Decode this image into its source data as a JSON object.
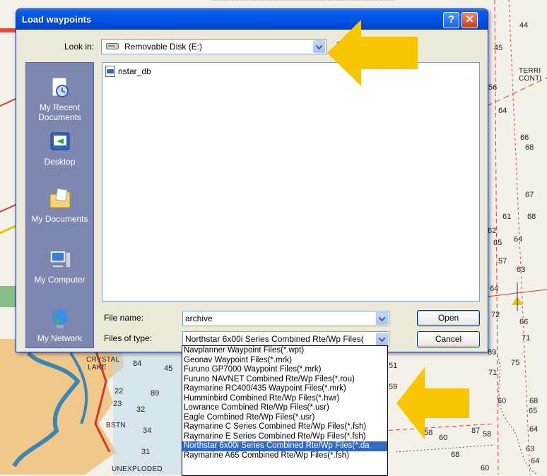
{
  "dialog": {
    "title": "Load waypoints",
    "help_glyph": "?",
    "close_glyph": "✕",
    "look_in_label": "Look in:",
    "look_in_value": "Removable Disk (E:)",
    "places": [
      {
        "label_1": "My Recent",
        "label_2": "Documents",
        "icon": "recent-documents-icon"
      },
      {
        "label_1": "Desktop",
        "icon": "desktop-icon"
      },
      {
        "label_1": "My Documents",
        "icon": "my-documents-icon"
      },
      {
        "label_1": "My Computer",
        "icon": "my-computer-icon"
      },
      {
        "label_1": "My Network",
        "icon": "my-network-icon"
      }
    ],
    "files": [
      {
        "name": "nstar_db",
        "icon": "database-file-icon"
      }
    ],
    "file_name_label": "File name:",
    "file_name_value": "archive",
    "files_of_type_label": "Files of type:",
    "files_of_type_value": "Northstar 6x00i Series Combined Rte/Wp Files(",
    "open_label": "Open",
    "cancel_label": "Cancel"
  },
  "file_type_options": [
    "Navplanner Waypoint Files(*.wpt)",
    "Geonav Waypoint Files(*.mrk)",
    "Furuno GP7000 Waypoint Files(*.mrk)",
    "Furuno NAVNET Combined Rte/Wp Files(*.rou)",
    "Raymarine RC400/435 Waypoint Files(*.mrk)",
    "Humminbird Combined Rte/Wp Files(*.hwr)",
    "Lowrance Combined Rte/Wp Files(*.usr)",
    "Eagle Combined Rte/Wp Files(*.usr)",
    "Raymarine C Series Combined Rte/Wp Files(*.fsh)",
    "Raymarine E Series Combined Rte/Wp Files(*.fsh)",
    "Northstar 6x00i Series Combined Rte/Wp Files(*.da",
    "Raymarine A65 Combined Rte/Wp Files(*.fsh)"
  ],
  "selected_option_index": 10,
  "chart": {
    "labels": [
      "TERRI",
      "CONTI",
      "CRYSTAL",
      "LAKE",
      "BSTN",
      "UNEXPLODED"
    ],
    "depths": [
      "44",
      "45",
      "56",
      "64",
      "66",
      "68",
      "67",
      "61",
      "68",
      "62",
      "65",
      "64",
      "57",
      "63",
      "64",
      "72",
      "71",
      "89",
      "75",
      "71",
      "60",
      "68",
      "65",
      "64",
      "63",
      "64",
      "60",
      "58",
      "60",
      "84",
      "45",
      "89",
      "22",
      "23",
      "32",
      "31",
      "34",
      "51",
      "59",
      "87",
      "58",
      "68",
      "66"
    ],
    "highlight_arrow_color": "#f7c600"
  }
}
